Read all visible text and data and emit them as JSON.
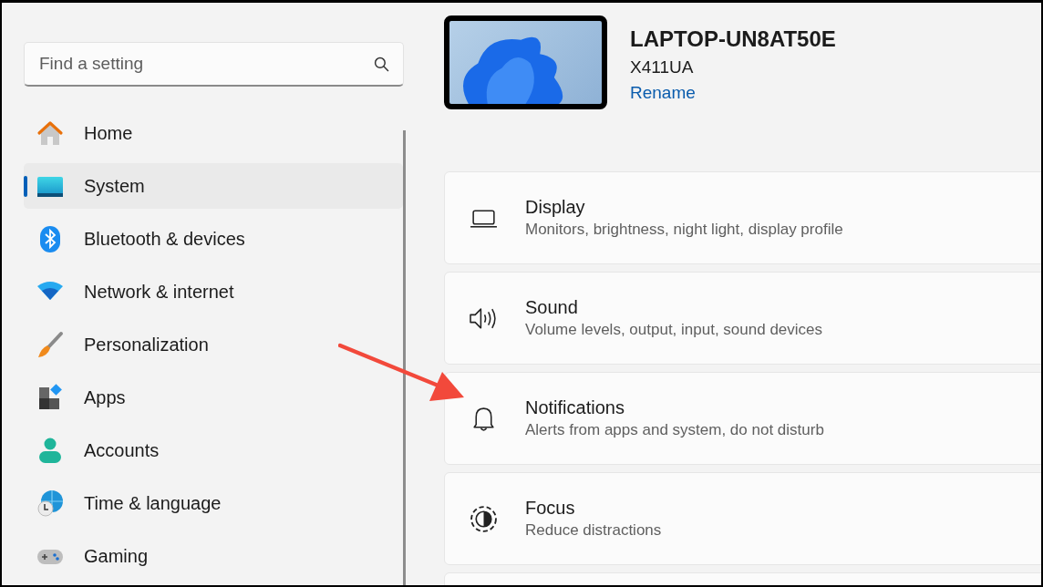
{
  "search": {
    "placeholder": "Find a setting"
  },
  "sidebar": {
    "items": [
      {
        "label": "Home",
        "selected": false
      },
      {
        "label": "System",
        "selected": true
      },
      {
        "label": "Bluetooth & devices",
        "selected": false
      },
      {
        "label": "Network & internet",
        "selected": false
      },
      {
        "label": "Personalization",
        "selected": false
      },
      {
        "label": "Apps",
        "selected": false
      },
      {
        "label": "Accounts",
        "selected": false
      },
      {
        "label": "Time & language",
        "selected": false
      },
      {
        "label": "Gaming",
        "selected": false
      }
    ]
  },
  "device": {
    "name": "LAPTOP-UN8AT50E",
    "model": "X411UA",
    "rename_link": "Rename"
  },
  "settings": [
    {
      "title": "Display",
      "description": "Monitors, brightness, night light, display profile"
    },
    {
      "title": "Sound",
      "description": "Volume levels, output, input, sound devices"
    },
    {
      "title": "Notifications",
      "description": "Alerts from apps and system, do not disturb"
    },
    {
      "title": "Focus",
      "description": "Reduce distractions"
    }
  ]
}
